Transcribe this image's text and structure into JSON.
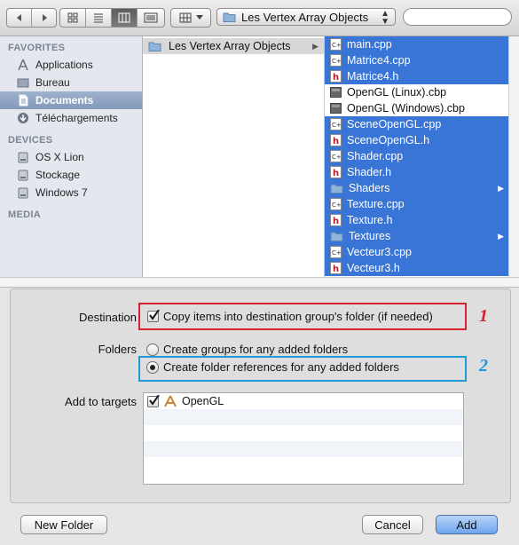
{
  "toolbar": {
    "back_icon": "chevron-left-icon",
    "forward_icon": "chevron-right-icon",
    "view_modes": [
      "icon-view",
      "list-view",
      "column-view",
      "coverflow-view"
    ],
    "active_view": "column-view",
    "arrange_icon": "grid-arrange-icon",
    "path_label": "Les Vertex Array Objects",
    "search": {
      "value": "",
      "placeholder": ""
    }
  },
  "sidebar": {
    "favorites_header": "FAVORITES",
    "favorites": [
      {
        "label": "Applications",
        "icon": "applications-icon"
      },
      {
        "label": "Bureau",
        "icon": "desktop-icon"
      },
      {
        "label": "Documents",
        "icon": "documents-icon",
        "selected": true
      },
      {
        "label": "Téléchargements",
        "icon": "downloads-icon"
      }
    ],
    "devices_header": "DEVICES",
    "devices": [
      {
        "label": "OS X Lion",
        "icon": "disk-icon"
      },
      {
        "label": "Stockage",
        "icon": "disk-icon"
      },
      {
        "label": "Windows 7",
        "icon": "disk-icon"
      }
    ],
    "media_header": "MEDIA"
  },
  "browser": {
    "column1": [
      {
        "name": "Les Vertex Array Objects",
        "type": "folder"
      }
    ],
    "column2": [
      {
        "name": "main.cpp",
        "type": "cpp",
        "selected": true
      },
      {
        "name": "Matrice4.cpp",
        "type": "cpp",
        "selected": true
      },
      {
        "name": "Matrice4.h",
        "type": "h",
        "selected": true
      },
      {
        "name": "OpenGL (Linux).cbp",
        "type": "cbp",
        "selected": false
      },
      {
        "name": "OpenGL (Windows).cbp",
        "type": "cbp",
        "selected": false
      },
      {
        "name": "SceneOpenGL.cpp",
        "type": "cpp",
        "selected": true
      },
      {
        "name": "SceneOpenGL.h",
        "type": "h",
        "selected": true
      },
      {
        "name": "Shader.cpp",
        "type": "cpp",
        "selected": true
      },
      {
        "name": "Shader.h",
        "type": "h",
        "selected": true
      },
      {
        "name": "Shaders",
        "type": "folder",
        "selected": true
      },
      {
        "name": "Texture.cpp",
        "type": "cpp",
        "selected": true
      },
      {
        "name": "Texture.h",
        "type": "h",
        "selected": true
      },
      {
        "name": "Textures",
        "type": "folder",
        "selected": true
      },
      {
        "name": "Vecteur3.cpp",
        "type": "cpp",
        "selected": true
      },
      {
        "name": "Vecteur3.h",
        "type": "h",
        "selected": true
      }
    ]
  },
  "options": {
    "destination_label": "Destination",
    "copy_items_label": "Copy items into destination group's folder (if needed)",
    "copy_items_checked": true,
    "folders_label": "Folders",
    "groups_option": "Create groups for any added folders",
    "references_option": "Create folder references for any added folders",
    "selected_folder_option": "references",
    "add_to_targets_label": "Add to targets",
    "targets": [
      {
        "name": "OpenGL",
        "checked": true,
        "icon": "app-target-icon"
      }
    ]
  },
  "annotations": {
    "mark1": "1",
    "mark1_color": "#d8202e",
    "mark2": "2",
    "mark2_color": "#1f9ad6"
  },
  "buttons": {
    "new_folder": "New Folder",
    "cancel": "Cancel",
    "add": "Add"
  }
}
